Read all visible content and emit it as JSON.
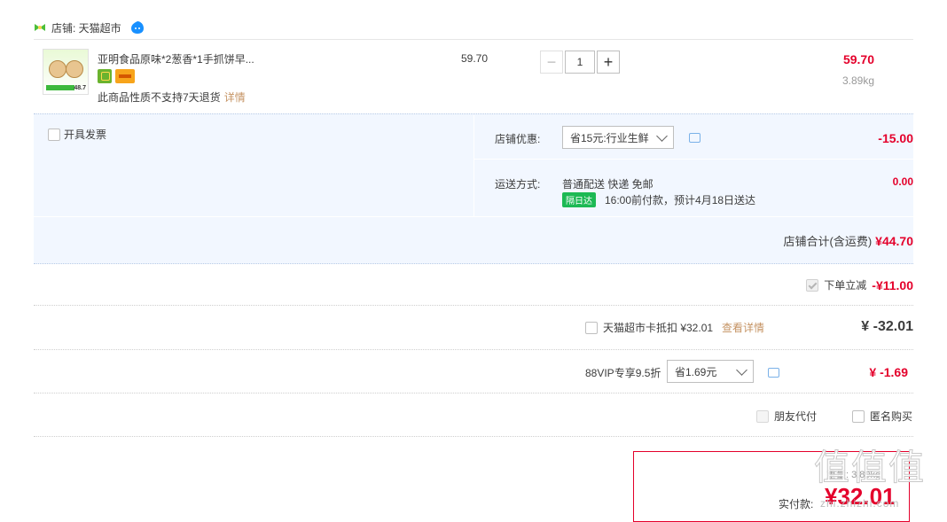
{
  "shop": {
    "label": "店铺: 天猫超市"
  },
  "item": {
    "title": "亚明食品原味*2葱香*1手抓饼早...",
    "thumb_price": "48.7",
    "no_return": "此商品性质不支持7天退货",
    "details_link": "详情",
    "unit_price": "59.70",
    "quantity": "1",
    "minus": "−",
    "plus": "+",
    "subtotal": "59.70",
    "weight": "3.89kg"
  },
  "invoice": {
    "label": "开具发票"
  },
  "promo": {
    "label": "店铺优惠:",
    "selected": "省15元:行业生鲜",
    "amount": "-15.00"
  },
  "shipping": {
    "label": "运送方式:",
    "method": "普通配送 快递 免邮",
    "badge": "隔日达",
    "eta": "16:00前付款，预计4月18日送达",
    "amount": "0.00"
  },
  "shop_total": {
    "label": "店铺合计(含运费)",
    "value": "¥44.70"
  },
  "discount": {
    "label": "下单立减",
    "value": "-¥11.00",
    "checked": true
  },
  "card": {
    "label": "天猫超市卡抵扣 ¥32.01",
    "link": "查看详情",
    "value": "¥ -32.01"
  },
  "vip": {
    "label": "88VIP专享9.5折",
    "selected": "省1.69元",
    "value": "¥ -1.69"
  },
  "options": {
    "friend": "朋友代付",
    "anon": "匿名购买"
  },
  "pay": {
    "label": "实付款:",
    "amount": "¥32.01",
    "sub": "重量: 3.89kg"
  },
  "watermark": {
    "big": "值值值",
    "small": "zhi.zhizhi.com"
  },
  "colors": {
    "price_red": "#e4002b",
    "panel_bg": "#f2f7ff",
    "link_tan": "#c59363"
  }
}
